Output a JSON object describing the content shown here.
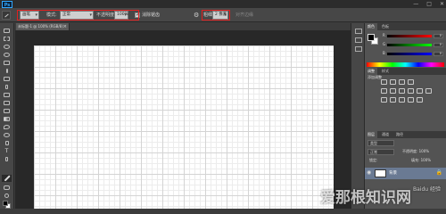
{
  "menubar": {
    "logo": "Ps",
    "window_controls": [
      "—",
      "□",
      "✕"
    ]
  },
  "options": {
    "mode_label": "模式:",
    "mode_value": "正常",
    "blend_value": "画笔",
    "opacity_label": "不透明度:",
    "opacity_value": "100%",
    "smoothing_label": "消除锯齿",
    "weight_label": "粗细:",
    "weight_value": "2 像素",
    "align_label": "对齐边缘"
  },
  "document": {
    "tab_title": "未标题-1 @ 100% (RGB/8)",
    "close_glyph": "×"
  },
  "panels": {
    "color_tab": "颜色",
    "swatches_tab": "色板",
    "sliders": [
      {
        "label": "R",
        "value": "0",
        "color": "#ff0000"
      },
      {
        "label": "G",
        "value": "0",
        "color": "#00ff00"
      },
      {
        "label": "B",
        "value": "0",
        "color": "#0000ff"
      }
    ],
    "adjustments_tab": "调整",
    "styles_tab": "样式",
    "adjustments_title": "添加调整",
    "layers_tab": "图层",
    "channels_tab": "通道",
    "paths_tab": "路径",
    "layer_kind": "类型",
    "blend_mode": "正常",
    "opacity_label": "不透明度: 100%",
    "lock_label": "锁定:",
    "fill_label": "填充: 100%",
    "layer_name": "背景"
  },
  "watermark": {
    "text": "爱那根知识网",
    "sub": "Baidu 经验"
  },
  "colors": {
    "highlight": "#e02020",
    "ps_blue": "#31a8ff",
    "foreground": "#000000",
    "background": "#ffffff"
  }
}
